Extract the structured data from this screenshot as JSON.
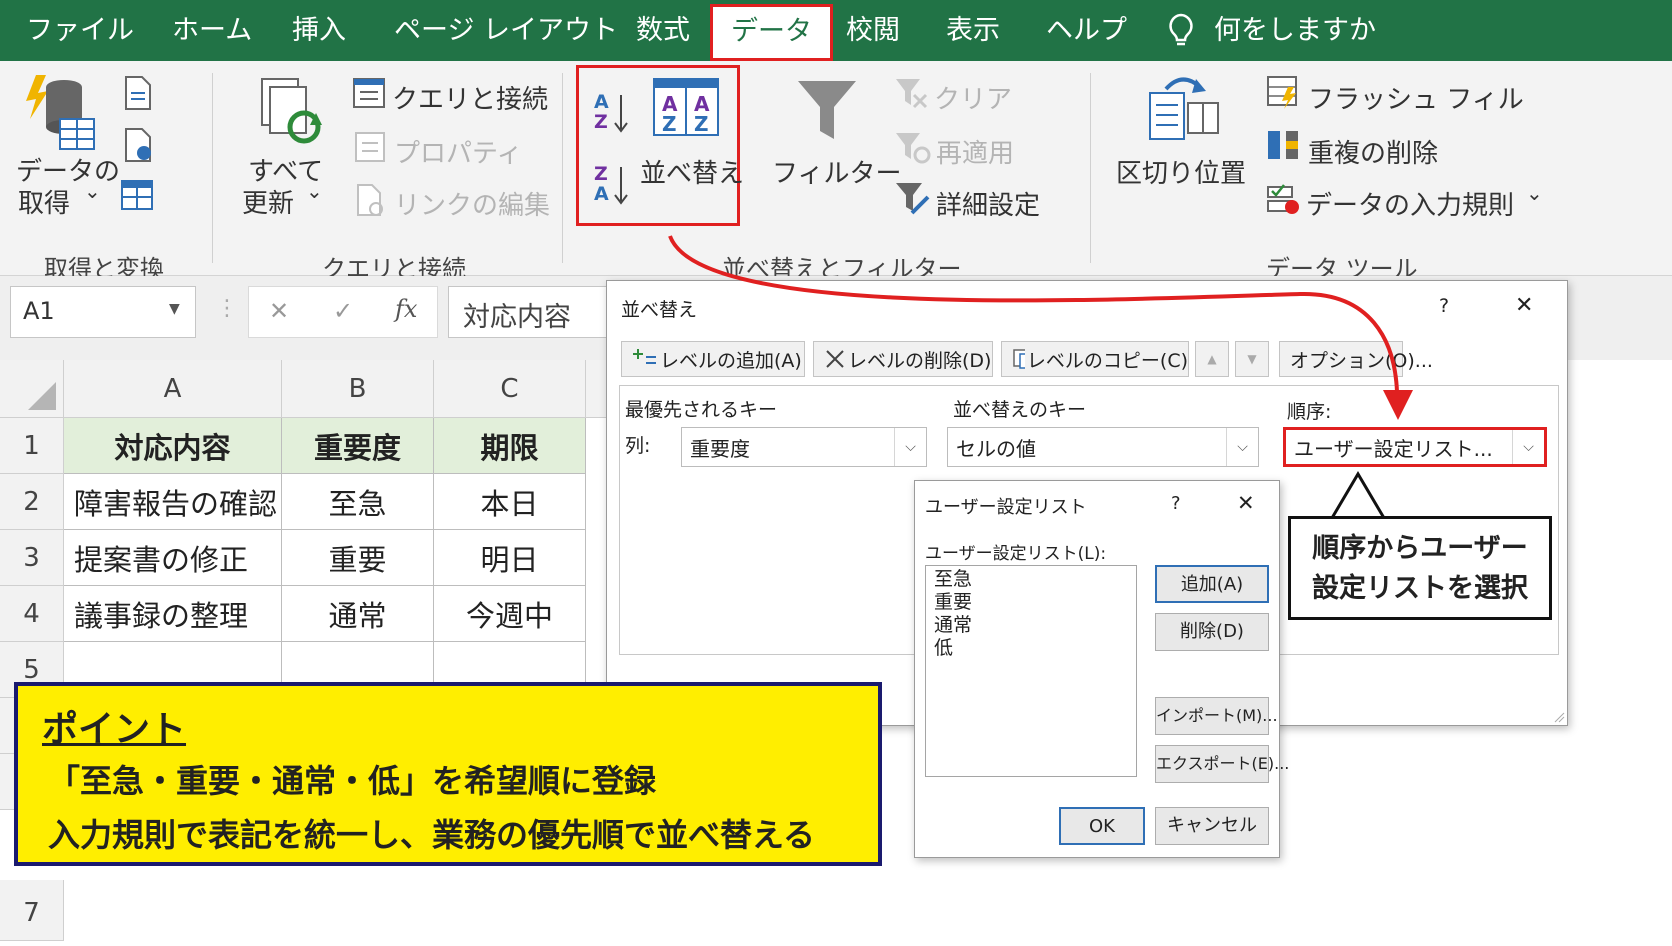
{
  "menu": {
    "file": "ファイル",
    "home": "ホーム",
    "insert": "挿入",
    "layout": "ページ レイアウト",
    "formulas": "数式",
    "data": "データ",
    "review": "校閲",
    "view": "表示",
    "help": "ヘルプ",
    "tell_me": "何をしますか"
  },
  "ribbon": {
    "get_data_line1": "データの",
    "get_data_line2": "取得",
    "get_data_caret": "⌄",
    "group_get_transform": "取得と変換",
    "refresh_line1": "すべて",
    "refresh_line2": "更新",
    "refresh_caret": "⌄",
    "queries_connections": "クエリと接続",
    "properties": "プロパティ",
    "edit_links": "リンクの編集",
    "group_queries": "クエリと接続",
    "sort_az_top": "A",
    "sort_az_bottom": "Z",
    "sort_za_top": "Z",
    "sort_za_bottom": "A",
    "sort": "並べ替え",
    "filter": "フィルター",
    "clear": "クリア",
    "reapply": "再適用",
    "advanced": "詳細設定",
    "group_sort_filter": "並べ替えとフィルター",
    "text_to_columns": "区切り位置",
    "flash_fill": "フラッシュ フィル",
    "remove_duplicates": "重複の削除",
    "data_validation": "データの入力規則",
    "data_validation_caret": "⌄",
    "group_data_tools": "データ ツール"
  },
  "formula_bar": {
    "name_box": "A1",
    "cancel": "✕",
    "enter": "✓",
    "fx": "fx",
    "content": "対応内容"
  },
  "grid": {
    "columns": [
      "A",
      "B",
      "C"
    ],
    "rows": [
      "1",
      "2",
      "3",
      "4",
      "5",
      "7"
    ],
    "cells": [
      [
        "対応内容",
        "重要度",
        "期限"
      ],
      [
        "障害報告の確認",
        "至急",
        "本日"
      ],
      [
        "提案書の修正",
        "重要",
        "明日"
      ],
      [
        "議事録の整理",
        "通常",
        "今週中"
      ]
    ]
  },
  "sort_dialog": {
    "title": "並べ替え",
    "help": "?",
    "close": "✕",
    "add_level": "レベルの追加(A)",
    "delete_level": "レベルの削除(D)",
    "copy_level": "レベルのコピー(C)",
    "up": "▲",
    "down": "▼",
    "options": "オプション(O)...",
    "header_key": "最優先されるキー",
    "header_sort_on": "並べ替えのキー",
    "header_order": "順序:",
    "row_label": "列:",
    "key_value": "重要度",
    "sort_on_value": "セルの値",
    "order_value": "ユーザー設定リスト...",
    "caret": "⌵"
  },
  "custom_dialog": {
    "title": "ユーザー設定リスト",
    "help": "?",
    "close": "✕",
    "list_label": "ユーザー設定リスト(L):",
    "items": [
      "至急",
      "重要",
      "通常",
      "低"
    ],
    "add": "追加(A)",
    "delete": "削除(D)",
    "import": "インポート(M)...",
    "export": "エクスポート(E)...",
    "ok": "OK",
    "cancel": "キャンセル"
  },
  "callout": {
    "line1": "順序からユーザー",
    "line2": "設定リストを選択"
  },
  "point": {
    "title": "ポイント",
    "line1": "「至急・重要・通常・低」を希望順に登録",
    "line2": "入力規則で表記を統一し、業務の優先順で並べ替える"
  },
  "colors": {
    "excel_green": "#217346",
    "highlight_red": "#e02020",
    "point_yellow": "#ffee00",
    "point_border": "#1a1a6e",
    "header_fill": "#e2efda"
  }
}
